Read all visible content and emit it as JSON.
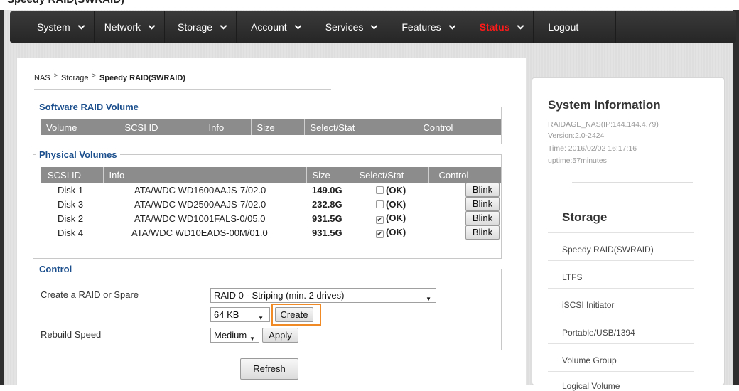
{
  "top_strip_text": "Speedy RAID(SWRAID)",
  "nav": {
    "items": [
      {
        "label": "System"
      },
      {
        "label": "Network"
      },
      {
        "label": "Storage"
      },
      {
        "label": "Account"
      },
      {
        "label": "Services"
      },
      {
        "label": "Features"
      },
      {
        "label": "Status"
      },
      {
        "label": "Logout"
      }
    ],
    "status_color": "#ff1a1a"
  },
  "breadcrumb": {
    "root": "NAS",
    "section": "Storage",
    "current": "Speedy RAID(SWRAID)"
  },
  "software_raid": {
    "legend": "Software RAID Volume",
    "headers": [
      "Volume",
      "SCSI ID",
      "Info",
      "Size",
      "Select/Stat",
      "Control"
    ]
  },
  "physical": {
    "legend": "Physical Volumes",
    "headers": [
      "SCSI ID",
      "Info",
      "Size",
      "Select/Stat",
      "Control"
    ],
    "rows": [
      {
        "scsi": "Disk 1",
        "info": "ATA/WDC WD1600AAJS-7/02.0",
        "size": "149.0G",
        "checked": false,
        "stat": "(OK)",
        "control": "Blink"
      },
      {
        "scsi": "Disk 3",
        "info": "ATA/WDC WD2500AAJS-7/02.0",
        "size": "232.8G",
        "checked": false,
        "stat": "(OK)",
        "control": "Blink"
      },
      {
        "scsi": "Disk 2",
        "info": "ATA/WDC WD1001FALS-0/05.0",
        "size": "931.5G",
        "checked": true,
        "stat": "(OK)",
        "control": "Blink"
      },
      {
        "scsi": "Disk 4",
        "info": "ATA/WDC WD10EADS-00M/01.0",
        "size": "931.5G",
        "checked": true,
        "stat": "(OK)",
        "control": "Blink"
      }
    ]
  },
  "control": {
    "legend": "Control",
    "create_label": "Create a RAID or Spare",
    "raid_select": "RAID 0 - Striping (min. 2 drives)",
    "stripe_select": "64 KB",
    "create_button": "Create",
    "rebuild_label": "Rebuild Speed",
    "rebuild_select": "Medium",
    "apply_button": "Apply",
    "highlight_color": "#f08a24"
  },
  "refresh_button": "Refresh",
  "sidebar": {
    "sysinfo_title": "System Information",
    "host": "RAIDAGE_NAS(IP:144.144.4.79)",
    "version": "Version:2.0-2424",
    "time": "Time: 2016/02/02 16:17:16",
    "uptime": "uptime:57minutes",
    "storage_title": "Storage",
    "storage_items": [
      "Speedy RAID(SWRAID)",
      "LTFS",
      "iSCSI Initiator",
      "Portable/USB/1394",
      "Volume Group",
      "Logical Volume"
    ]
  }
}
